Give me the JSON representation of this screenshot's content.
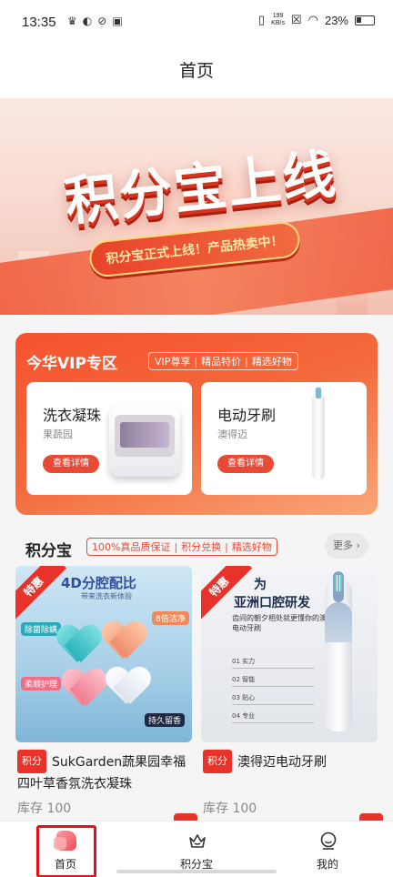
{
  "status_bar": {
    "time": "13:35",
    "net_speed_value": "199",
    "net_speed_unit": "KB/s",
    "battery": "23%"
  },
  "header": {
    "title": "首页"
  },
  "banner": {
    "headline": "积分宝上线",
    "subline": "积分宝正式上线！产品热卖中！"
  },
  "vip": {
    "title": "今华VIP专区",
    "tags": [
      "VIP尊享",
      "精品特价",
      "精选好物"
    ],
    "cards": [
      {
        "name": "洗衣凝珠",
        "brand": "果蔬园",
        "button": "查看详情"
      },
      {
        "name": "电动牙刷",
        "brand": "澳得迈",
        "button": "查看详情"
      }
    ]
  },
  "points_section": {
    "title": "积分宝",
    "tags": [
      "100%真品质保证",
      "积分兑换",
      "精选好物"
    ],
    "more": "更多"
  },
  "products": [
    {
      "hot_badge": "特惠",
      "image_headline": "4D分腔配比",
      "image_sub": "带来洗衣新体验",
      "image_tags": [
        "除菌除螨",
        "8倍洁净",
        "柔顺护理",
        "持久留香"
      ],
      "tag": "积分",
      "title": "SukGarden蔬果园幸福四叶草香氛洗衣凝珠",
      "stock": "库存 100"
    },
    {
      "hot_badge": "特惠",
      "image_headline_1": "为",
      "image_headline_2": "亚洲口腔研发",
      "image_text": "齿间的朝夕相处就更懂你的澳得迈电动牙刷",
      "image_features": [
        "01  实力",
        "02  智能",
        "03  贴心",
        "04  专业"
      ],
      "tag": "积分",
      "title": "澳得迈电动牙刷",
      "stock": "库存 100"
    }
  ],
  "tabbar": {
    "items": [
      {
        "label": "首页",
        "icon": "home-icon",
        "selected": true
      },
      {
        "label": "积分宝",
        "icon": "points-crown-icon"
      },
      {
        "label": "我的",
        "icon": "profile-icon"
      }
    ]
  },
  "colors": {
    "accent": "#e94a36",
    "selected_outline": "#e3111a"
  }
}
